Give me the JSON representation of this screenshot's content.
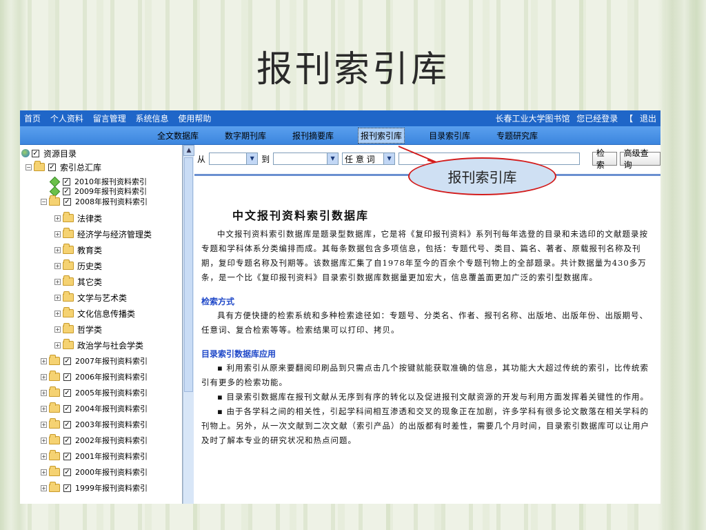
{
  "slide": {
    "title": "报刊索引库"
  },
  "topbar": {
    "nav": [
      "首页",
      "个人资料",
      "留言管理",
      "系统信息",
      "使用帮助"
    ],
    "library": "长春工业大学图书馆",
    "status": "您已经登录",
    "bracket": "【",
    "logout": "退出"
  },
  "tabs": [
    {
      "label": "全文数据库",
      "active": false
    },
    {
      "label": "数字期刊库",
      "active": false
    },
    {
      "label": "报刊摘要库",
      "active": false
    },
    {
      "label": "报刊索引库",
      "active": true
    },
    {
      "label": "目录索引库",
      "active": false
    },
    {
      "label": "专题研究库",
      "active": false
    }
  ],
  "tree": {
    "root": "资源目录",
    "level1": "索引总汇库",
    "items_2010": "2010年报刊资料索引",
    "items_2009": "2009年报刊资料索引",
    "items_2008": "2008年报刊资料索引",
    "sub_2008": [
      "法律类",
      "经济学与经济管理类",
      "教育类",
      "历史类",
      "其它类",
      "文学与艺术类",
      "文化信息传播类",
      "哲学类",
      "政治学与社会学类"
    ],
    "years": [
      "2007年报刊资料索引",
      "2006年报刊资料索引",
      "2005年报刊资料索引",
      "2004年报刊资料索引",
      "2003年报刊资料索引",
      "2002年报刊资料索引",
      "2001年报刊资料索引",
      "2000年报刊资料索引",
      "1999年报刊资料索引"
    ]
  },
  "search": {
    "from_label": "从",
    "to_label": "到",
    "field_value": "任 意 词",
    "search_button": "检索",
    "advanced_button": "高级查询"
  },
  "callout": {
    "text": "报刊索引库"
  },
  "article": {
    "title": "中文报刊资料索引数据库",
    "intro": "中文报刊资料索引数据库是题录型数据库，它是将《复印报刊资料》系列刊每年选登的目录和未选印的文献题录按专题和学科体系分类编排而成。其每条数据包含多项信息，包括：专题代号、类目、篇名、著者、原载报刊名称及刊期，复印专题名称及刊期等。该数据库汇集了自1978年至今的百余个专题刊物上的全部题录。共计数据量为430多万条，是一个比《复印报刊资料》目录索引数据库数据量更加宏大，信息覆盖面更加广泛的索引型数据库。",
    "section1_title": "检索方式",
    "section1_text": "具有方便快捷的检索系统和多种检索途径如：专题号、分类名、作者、报刊名称、出版地、出版年份、出版期号、任意词、复合检索等等。检索结果可以打印、拷贝。",
    "section2_title": "目录索引数据库应用",
    "bullets": [
      "▪ 利用索引从原来要翻阅印刷品到只需点击几个按键就能获取准确的信息，其功能大大超过传统的索引，比传统索引有更多的检索功能。",
      "▪ 目录索引数据库在报刊文献从无序到有序的转化以及促进报刊文献资源的开发与利用方面发挥着关键性的作用。",
      "▪ 由于各学科之间的相关性，引起学科间相互渗透和交叉的现象正在加剧，许多学科有很多论文散落在相关学科的刊物上。另外，从一次文献到二次文献（索引产品）的出版都有时差性，需要几个月时间，目录索引数据库可以让用户及时了解本专业的研究状况和热点问题。"
    ]
  }
}
